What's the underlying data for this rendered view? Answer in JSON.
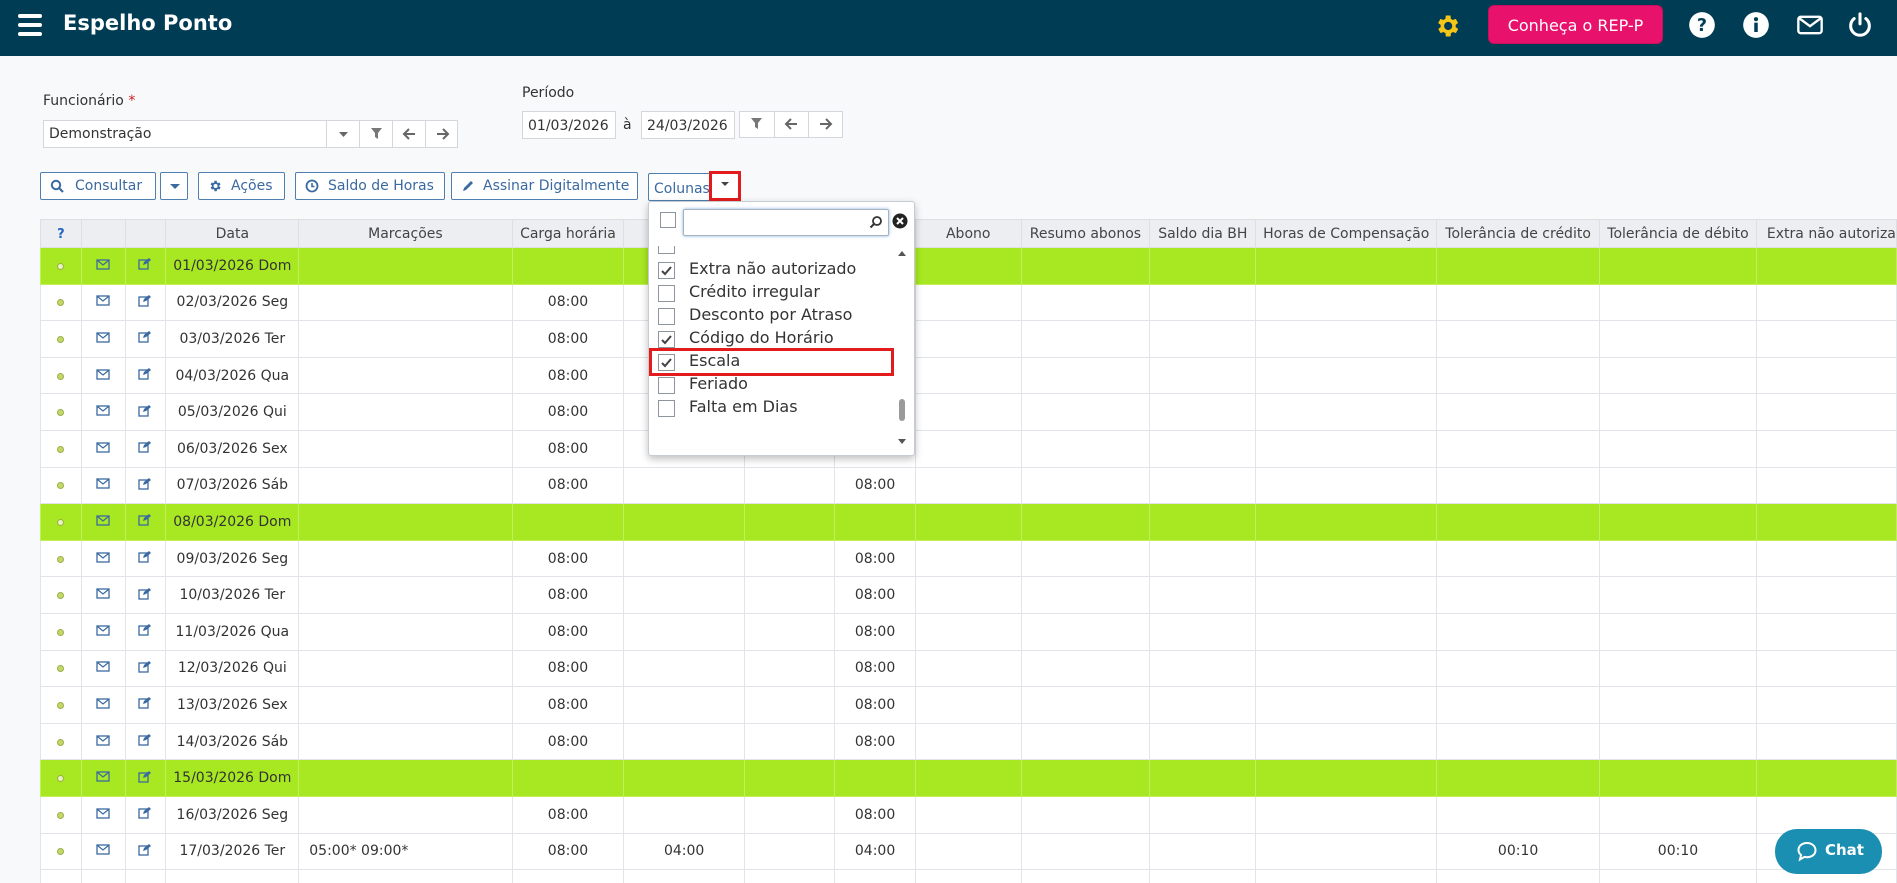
{
  "header": {
    "title": "Espelho Ponto",
    "rep_button": "Conheça o REP-P",
    "accent": "#003d55",
    "rep_color": "#e8116b"
  },
  "filters": {
    "employee_label": "Funcionário",
    "required_mark": "*",
    "employee_value": "Demonstração",
    "period_label": "Período",
    "date_from": "01/03/2026",
    "date_sep": "à",
    "date_to": "24/03/2026"
  },
  "actions": {
    "consultar": "Consultar",
    "acoes": "Ações",
    "saldo": "Saldo de Horas",
    "assinar": "Assinar Digitalmente",
    "colunas": "Colunas"
  },
  "table": {
    "help": "?",
    "headers": {
      "data": "Data",
      "marcacoes": "Marcações",
      "carga": "Carga horária",
      "abono": "Abono",
      "resumo": "Resumo abonos",
      "saldo_bh": "Saldo dia BH",
      "horas_comp": "Horas de Compensação",
      "tol_credito": "Tolerância de crédito",
      "tol_debito": "Tolerância de débito",
      "extra_na": "Extra não autoriza"
    },
    "rows": [
      {
        "date": "01/03/2026 Dom",
        "marc": "",
        "carga": "",
        "c4": "",
        "c6": "",
        "tolc": "",
        "told": "",
        "sunday": true
      },
      {
        "date": "02/03/2026 Seg",
        "marc": "",
        "carga": "08:00",
        "c4": "",
        "c6": "",
        "tolc": "",
        "told": "",
        "sunday": false
      },
      {
        "date": "03/03/2026 Ter",
        "marc": "",
        "carga": "08:00",
        "c4": "",
        "c6": "",
        "tolc": "",
        "told": "",
        "sunday": false
      },
      {
        "date": "04/03/2026 Qua",
        "marc": "",
        "carga": "08:00",
        "c4": "",
        "c6": "",
        "tolc": "",
        "told": "",
        "sunday": false
      },
      {
        "date": "05/03/2026 Qui",
        "marc": "",
        "carga": "08:00",
        "c4": "",
        "c6": "",
        "tolc": "",
        "told": "",
        "sunday": false
      },
      {
        "date": "06/03/2026 Sex",
        "marc": "",
        "carga": "08:00",
        "c4": "",
        "c6": "",
        "tolc": "",
        "told": "",
        "sunday": false
      },
      {
        "date": "07/03/2026 Sáb",
        "marc": "",
        "carga": "08:00",
        "c4": "",
        "c6": "08:00",
        "tolc": "",
        "told": "",
        "sunday": false
      },
      {
        "date": "08/03/2026 Dom",
        "marc": "",
        "carga": "",
        "c4": "",
        "c6": "",
        "tolc": "",
        "told": "",
        "sunday": true
      },
      {
        "date": "09/03/2026 Seg",
        "marc": "",
        "carga": "08:00",
        "c4": "",
        "c6": "08:00",
        "tolc": "",
        "told": "",
        "sunday": false
      },
      {
        "date": "10/03/2026 Ter",
        "marc": "",
        "carga": "08:00",
        "c4": "",
        "c6": "08:00",
        "tolc": "",
        "told": "",
        "sunday": false
      },
      {
        "date": "11/03/2026 Qua",
        "marc": "",
        "carga": "08:00",
        "c4": "",
        "c6": "08:00",
        "tolc": "",
        "told": "",
        "sunday": false
      },
      {
        "date": "12/03/2026 Qui",
        "marc": "",
        "carga": "08:00",
        "c4": "",
        "c6": "08:00",
        "tolc": "",
        "told": "",
        "sunday": false
      },
      {
        "date": "13/03/2026 Sex",
        "marc": "",
        "carga": "08:00",
        "c4": "",
        "c6": "08:00",
        "tolc": "",
        "told": "",
        "sunday": false
      },
      {
        "date": "14/03/2026 Sáb",
        "marc": "",
        "carga": "08:00",
        "c4": "",
        "c6": "08:00",
        "tolc": "",
        "told": "",
        "sunday": false
      },
      {
        "date": "15/03/2026 Dom",
        "marc": "",
        "carga": "",
        "c4": "",
        "c6": "",
        "tolc": "",
        "told": "",
        "sunday": true
      },
      {
        "date": "16/03/2026 Seg",
        "marc": "",
        "carga": "08:00",
        "c4": "",
        "c6": "08:00",
        "tolc": "",
        "told": "",
        "sunday": false
      },
      {
        "date": "17/03/2026 Ter",
        "marc": "05:00* 09:00*",
        "carga": "08:00",
        "c4": "04:00",
        "c6": "04:00",
        "tolc": "00:10",
        "told": "00:10",
        "sunday": false
      },
      {
        "date": "",
        "marc": "",
        "carga": "",
        "c4": "",
        "c6": "",
        "tolc": "",
        "told": "",
        "sunday": false
      }
    ]
  },
  "columns_dropdown": {
    "search_placeholder": "",
    "items": [
      {
        "label": "Extra não autorizado",
        "checked": true
      },
      {
        "label": "Crédito irregular",
        "checked": false
      },
      {
        "label": "Desconto por Atraso",
        "checked": false
      },
      {
        "label": "Código do Horário",
        "checked": true
      },
      {
        "label": "Escala",
        "checked": true,
        "highlighted": true
      },
      {
        "label": "Feriado",
        "checked": false
      },
      {
        "label": "Falta em Dias",
        "checked": false
      }
    ]
  },
  "chat": {
    "label": "Chat"
  }
}
